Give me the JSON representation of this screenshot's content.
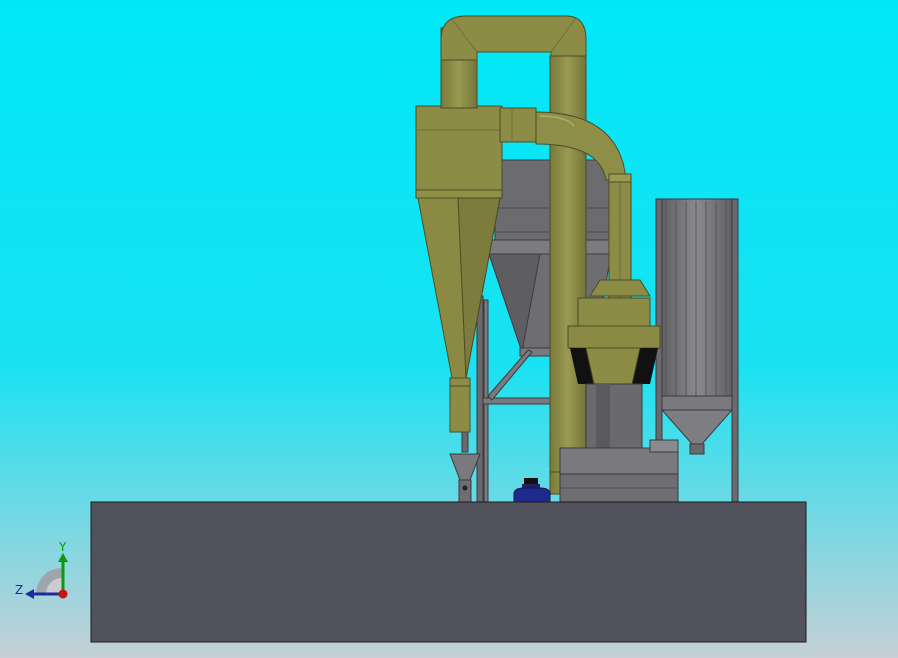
{
  "viewport": {
    "background_top": "#00E8F8",
    "background_bottom": "#C6D0D6"
  },
  "colors": {
    "duct_olive": "#8C8C46",
    "duct_olive_dark": "#6E6E34",
    "duct_olive_light": "#A0A058",
    "steel_gray": "#6C6C70",
    "steel_gray_light": "#8A8A8E",
    "steel_gray_dark": "#4E4E52",
    "base_slab": "#52525C",
    "motor_blue": "#1E2A8C",
    "black": "#111111",
    "axis_y_green": "#0A9A0A",
    "axis_z_blue": "#1C2C9C",
    "axis_origin_red": "#C41414"
  },
  "triad": {
    "y_label": "Y",
    "z_label": "Z"
  },
  "icons": {
    "triad": "coordinate-triad-icon"
  }
}
